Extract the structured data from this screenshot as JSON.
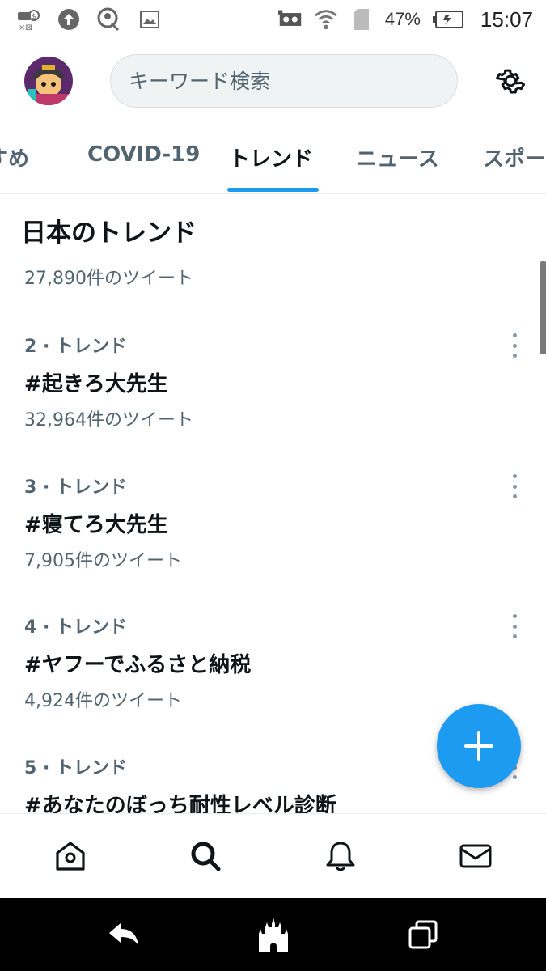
{
  "status_bar": {
    "battery_percent": "47%",
    "time": "15:07",
    "icons": [
      "usb-debug-icon",
      "upload-icon",
      "account-icon",
      "image-icon",
      "cassette-icon",
      "wifi-icon",
      "sim-icon",
      "battery-icon"
    ]
  },
  "header": {
    "avatar": "profile-avatar",
    "search_placeholder": "キーワード検索",
    "settings_icon": "gear-icon"
  },
  "tabs": [
    {
      "label": "すすめ",
      "active": false
    },
    {
      "label": "COVID-19",
      "active": false
    },
    {
      "label": "トレンド",
      "active": true
    },
    {
      "label": "ニュース",
      "active": false
    },
    {
      "label": "スポーツ",
      "active": false
    }
  ],
  "section": {
    "title": "日本のトレンド",
    "first_count": "27,890件のツイート"
  },
  "trends": [
    {
      "meta": "2 · トレンド",
      "name": "#起きろ大先生",
      "count": "32,964件のツイート"
    },
    {
      "meta": "3 · トレンド",
      "name": "#寝てろ大先生",
      "count": "7,905件のツイート"
    },
    {
      "meta": "4 · トレンド",
      "name": "#ヤフーでふるさと納税",
      "count": "4,924件のツイート"
    },
    {
      "meta": "5 · トレンド",
      "name": "#あなたのぼっち耐性レベル診断",
      "count": ""
    }
  ],
  "fab": {
    "icon": "plus-icon"
  },
  "bottom_nav": [
    "home-icon",
    "search-icon",
    "bell-icon",
    "mail-icon"
  ],
  "colors": {
    "accent": "#1d9bf0",
    "text": "#0f1419",
    "muted": "#536471"
  }
}
